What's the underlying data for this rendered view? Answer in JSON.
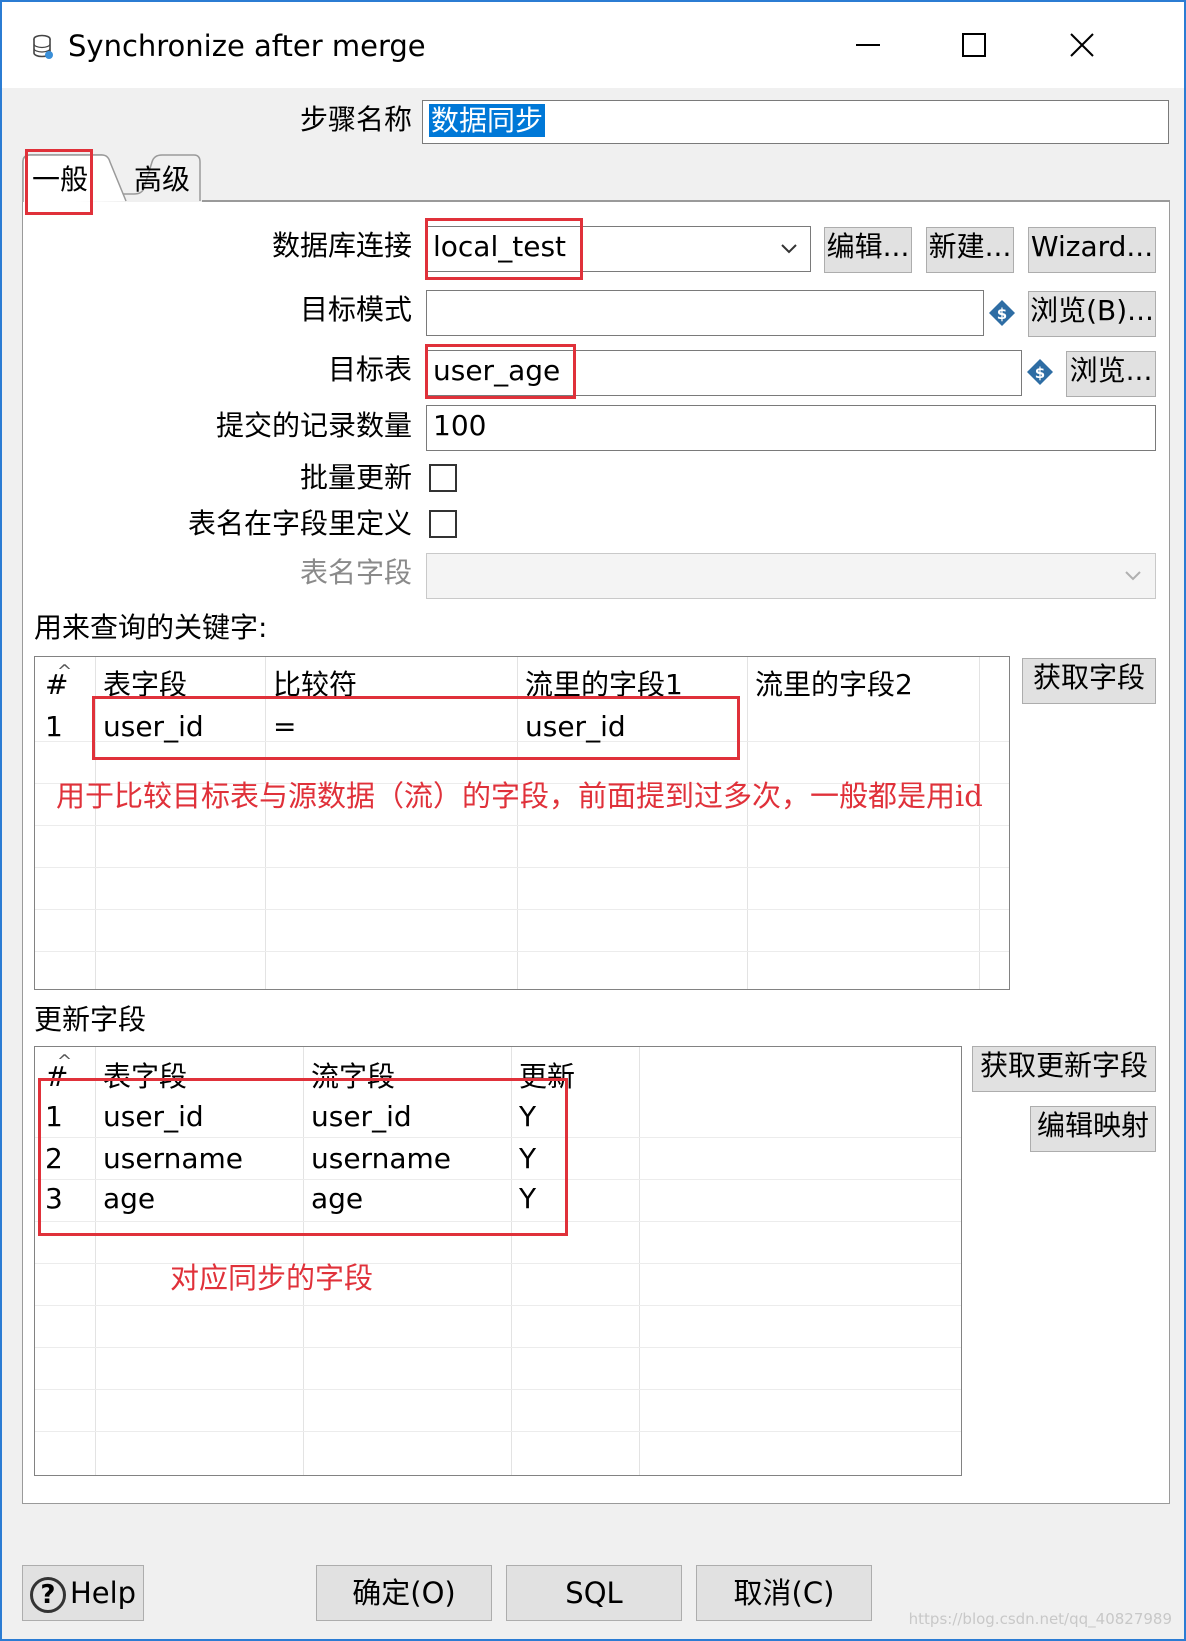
{
  "window": {
    "title": "Synchronize after merge",
    "controls": [
      "minimize",
      "maximize",
      "close"
    ]
  },
  "step": {
    "label": "步骤名称",
    "value": "数据同步"
  },
  "tabs": [
    {
      "label": "一般",
      "active": true
    },
    {
      "label": "高级",
      "active": false
    }
  ],
  "general": {
    "connection": {
      "label": "数据库连接",
      "value": "local_test",
      "edit": "编辑...",
      "new": "新建...",
      "wizard": "Wizard..."
    },
    "schema": {
      "label": "目标模式",
      "value": "",
      "browse": "浏览(B)..."
    },
    "table": {
      "label": "目标表",
      "value": "user_age",
      "browse": "浏览..."
    },
    "commit": {
      "label": "提交的记录数量",
      "value": "100"
    },
    "batch_update": {
      "label": "批量更新",
      "checked": false
    },
    "table_in_field": {
      "label": "表名在字段里定义",
      "checked": false
    },
    "table_field": {
      "label": "表名字段",
      "value": ""
    }
  },
  "keys": {
    "label": "用来查询的关键字:",
    "columns": [
      "#",
      "表字段",
      "比较符",
      "流里的字段1",
      "流里的字段2"
    ],
    "rows": [
      [
        "1",
        "user_id",
        "=",
        "user_id",
        ""
      ]
    ],
    "get_fields_button": "获取字段"
  },
  "update": {
    "label": "更新字段",
    "columns": [
      "#",
      "表字段",
      "流字段",
      "更新"
    ],
    "rows": [
      [
        "1",
        "user_id",
        "user_id",
        "Y"
      ],
      [
        "2",
        "username",
        "username",
        "Y"
      ],
      [
        "3",
        "age",
        "age",
        "Y"
      ]
    ],
    "get_update_button": "获取更新字段",
    "edit_mapping_button": "编辑映射"
  },
  "annotations": {
    "keys_note": "用于比较目标表与源数据（流）的字段，前面提到过多次，一般都是用id",
    "update_note": "对应同步的字段"
  },
  "footer": {
    "help": "Help",
    "ok": "确定(O)",
    "sql": "SQL",
    "cancel": "取消(C)"
  },
  "watermark": "https://blog.csdn.net/qq_40827989",
  "colors": {
    "accent": "#0078d7",
    "annotation": "#e0313a",
    "border": "#2b7cd3"
  }
}
